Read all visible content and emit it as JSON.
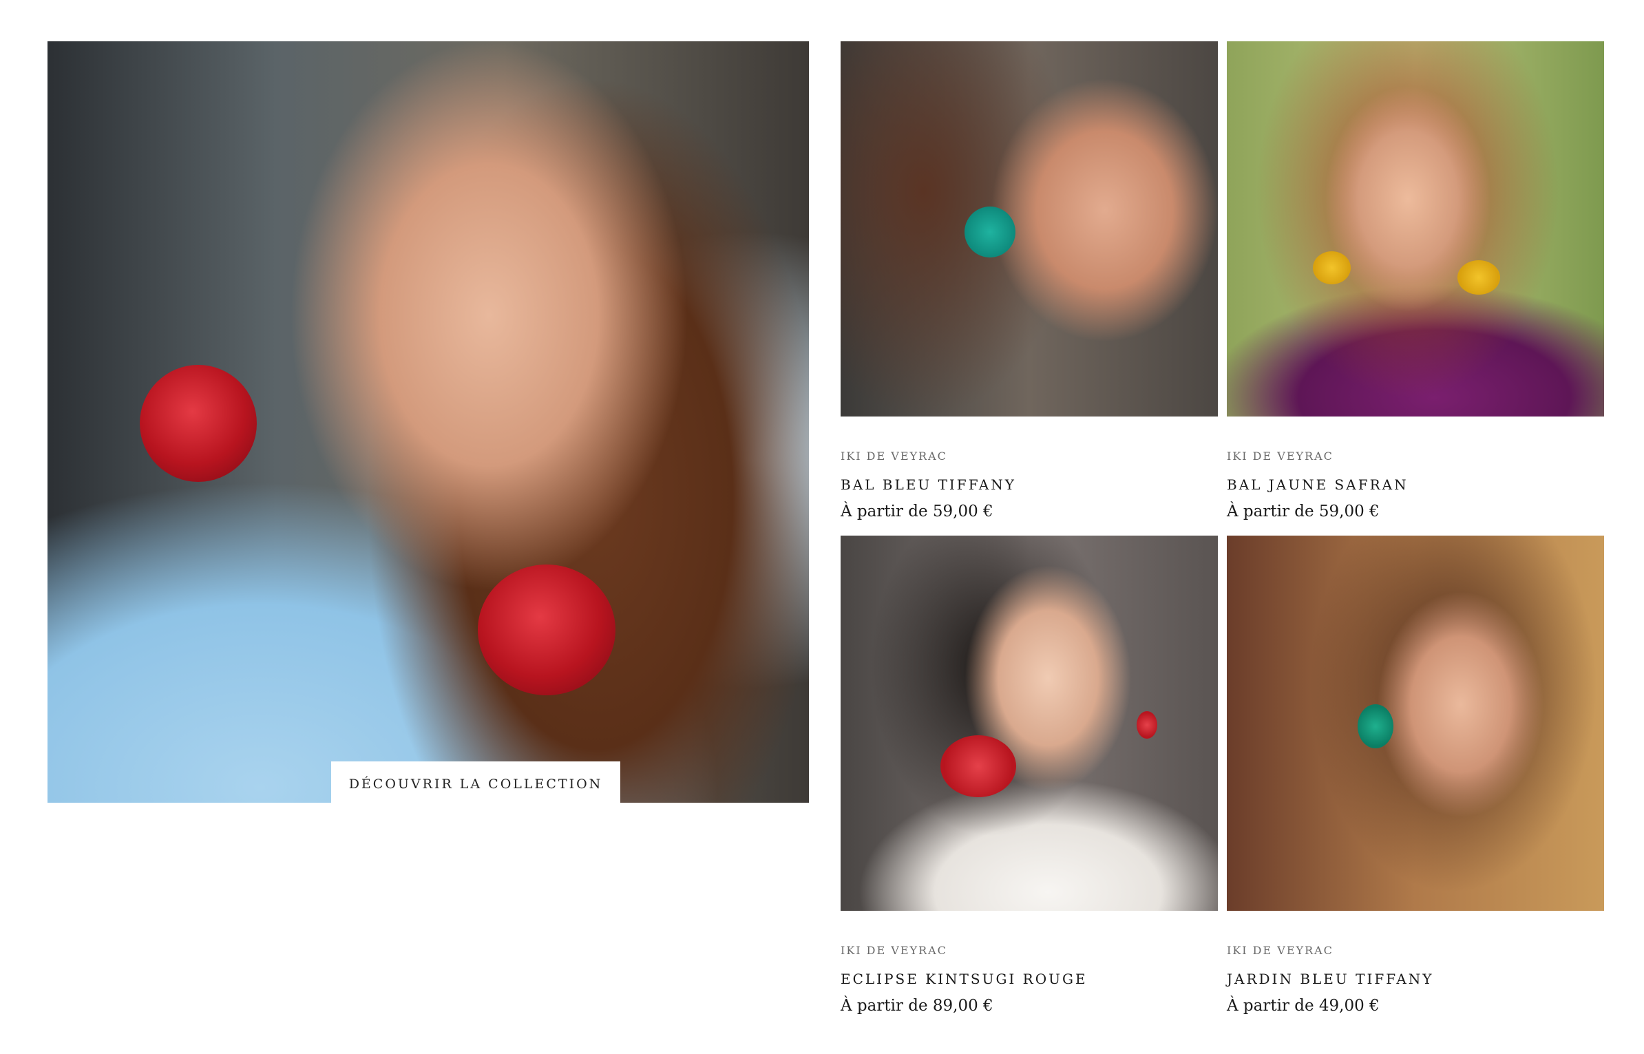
{
  "hero": {
    "cta_label": "DÉCOUVRIR LA COLLECTION"
  },
  "products": [
    {
      "brand": "IKI DE VEYRAC",
      "name": "BAL BLEU TIFFANY",
      "price": "À partir de 59,00 €"
    },
    {
      "brand": "IKI DE VEYRAC",
      "name": "BAL JAUNE SAFRAN",
      "price": "À partir de 59,00 €"
    },
    {
      "brand": "IKI DE VEYRAC",
      "name": "ECLIPSE KINTSUGI ROUGE",
      "price": "À partir de 89,00 €"
    },
    {
      "brand": "IKI DE VEYRAC",
      "name": "JARDIN BLEU TIFFANY",
      "price": "À partir de 49,00 €"
    }
  ]
}
